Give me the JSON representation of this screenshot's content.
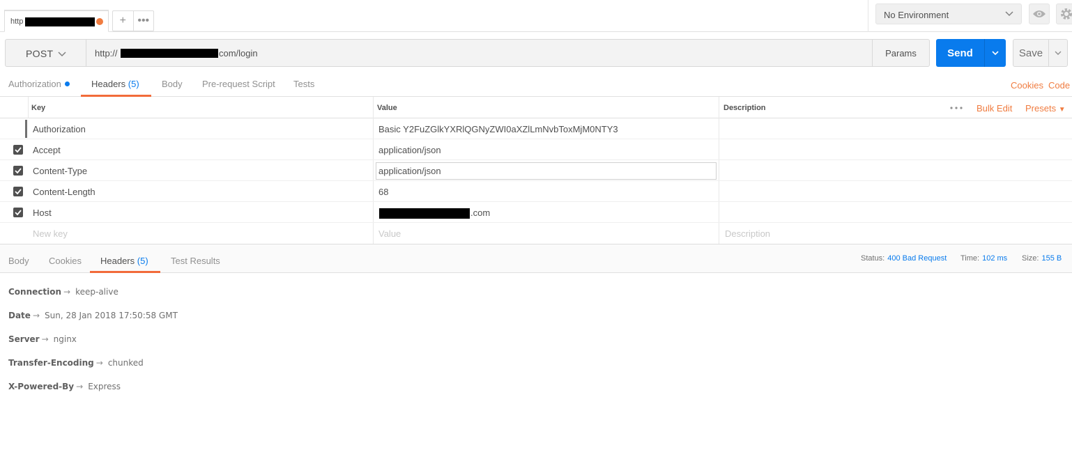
{
  "tabs": [
    {
      "label": "http"
    }
  ],
  "environment": {
    "selected": "No Environment"
  },
  "request": {
    "method": "POST",
    "url_prefix": "http://",
    "url_suffix": "com/login",
    "params_label": "Params",
    "send_label": "Send",
    "save_label": "Save"
  },
  "request_tabs": {
    "authorization": "Authorization",
    "headers": "Headers",
    "headers_count": "(5)",
    "body": "Body",
    "prerequest": "Pre-request Script",
    "tests": "Tests",
    "cookies": "Cookies",
    "code": "Code"
  },
  "headers_table": {
    "columns": {
      "key": "Key",
      "value": "Value",
      "description": "Description"
    },
    "bulk_edit": "Bulk Edit",
    "presets": "Presets",
    "rows": [
      {
        "key": "Authorization",
        "value": "Basic Y2FuZGlkYXRlQGNyZWI0aXZlLmNvbToxMjM0NTY3",
        "checked": false
      },
      {
        "key": "Accept",
        "value": "application/json",
        "checked": true
      },
      {
        "key": "Content-Type",
        "value": "application/json",
        "checked": true
      },
      {
        "key": "Content-Length",
        "value": "68",
        "checked": true
      },
      {
        "key": "Host",
        "value": ".com",
        "checked": true
      }
    ],
    "new_row": {
      "key_placeholder": "New key",
      "value_placeholder": "Value",
      "description_placeholder": "Description"
    }
  },
  "response_tabs": {
    "body": "Body",
    "cookies": "Cookies",
    "headers": "Headers",
    "headers_count": "(5)",
    "test_results": "Test Results"
  },
  "response_status": {
    "status_label": "Status:",
    "status_value": "400 Bad Request",
    "time_label": "Time:",
    "time_value": "102 ms",
    "size_label": "Size:",
    "size_value": "155 B"
  },
  "response_headers": [
    {
      "key": "Connection",
      "value": "keep-alive"
    },
    {
      "key": "Date",
      "value": "Sun, 28 Jan 2018 17:50:58 GMT"
    },
    {
      "key": "Server",
      "value": "nginx"
    },
    {
      "key": "Transfer-Encoding",
      "value": "chunked"
    },
    {
      "key": "X-Powered-By",
      "value": "Express"
    }
  ],
  "colors": {
    "accent_blue": "#097bed",
    "accent_orange": "#f26b3a"
  }
}
